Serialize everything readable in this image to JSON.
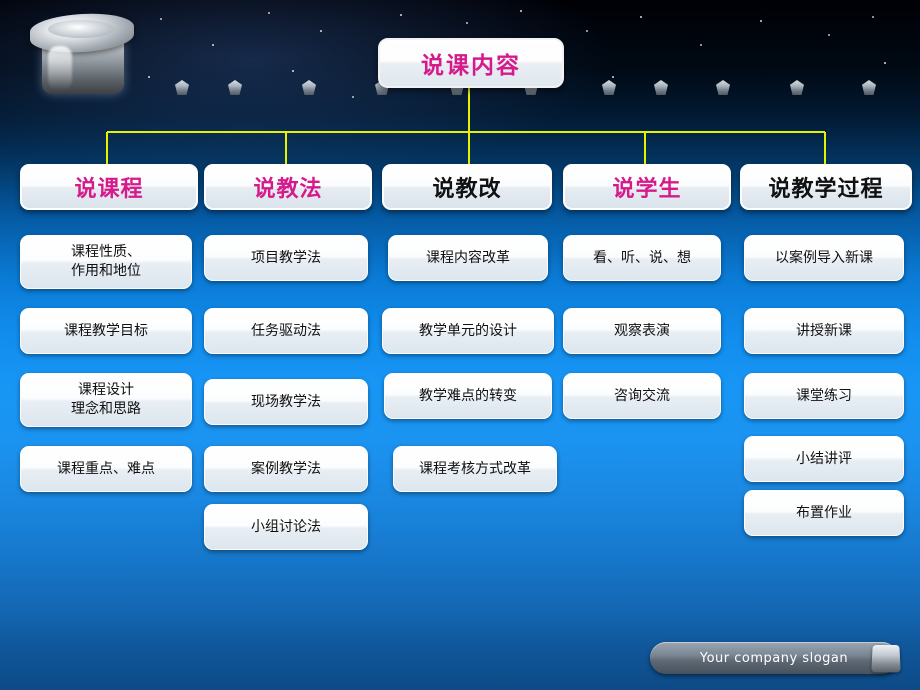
{
  "slide": {
    "title": "说课内容",
    "title_color": "#d61a8c",
    "accent_line_color": "#e8f200",
    "columns": [
      {
        "header": "说课程",
        "header_color": "#d61a8c",
        "items": [
          "课程性质、\n作用和地位",
          "课程教学目标",
          "课程设计\n理念和思路",
          "课程重点、难点"
        ]
      },
      {
        "header": "说教法",
        "header_color": "#d61a8c",
        "items": [
          "项目教学法",
          "任务驱动法",
          "现场教学法",
          "案例教学法",
          "小组讨论法"
        ]
      },
      {
        "header": "说教改",
        "header_color": "#111111",
        "items": [
          "课程内容改革",
          "教学单元的设计",
          "教学难点的转变",
          "课程考核方式改革"
        ]
      },
      {
        "header": "说学生",
        "header_color": "#d61a8c",
        "items": [
          "看、听、说、想",
          "观察表演",
          "咨询交流"
        ]
      },
      {
        "header": "说教学过程",
        "header_color": "#111111",
        "items": [
          "以案例导入新课",
          "讲授新课",
          "课堂练习",
          "小结讲评",
          "布置作业"
        ]
      }
    ]
  },
  "footer": {
    "slogan": "Your company slogan"
  }
}
